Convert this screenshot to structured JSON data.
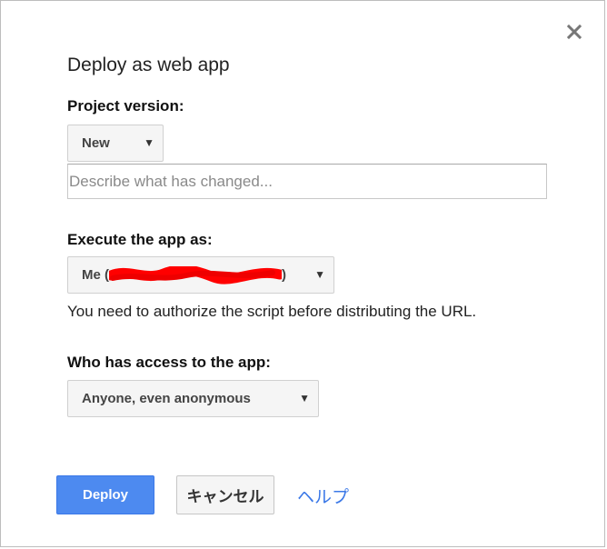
{
  "dialog": {
    "title": "Deploy as web app",
    "close_icon": "close-icon"
  },
  "project_version": {
    "label": "Project version:",
    "selected": "New",
    "description_placeholder": "Describe what has changed...",
    "description_value": ""
  },
  "execute_as": {
    "label": "Execute the app as:",
    "selected_prefix": "Me (",
    "selected_suffix": ")",
    "note": "You need to authorize the script before distributing the URL."
  },
  "access": {
    "label": "Who has access to the app:",
    "selected": "Anyone, even anonymous"
  },
  "buttons": {
    "deploy": "Deploy",
    "cancel": "キャンセル",
    "help": "ヘルプ"
  },
  "colors": {
    "primary": "#4d8af0",
    "link": "#3b78e7",
    "redaction": "#ff0000"
  }
}
